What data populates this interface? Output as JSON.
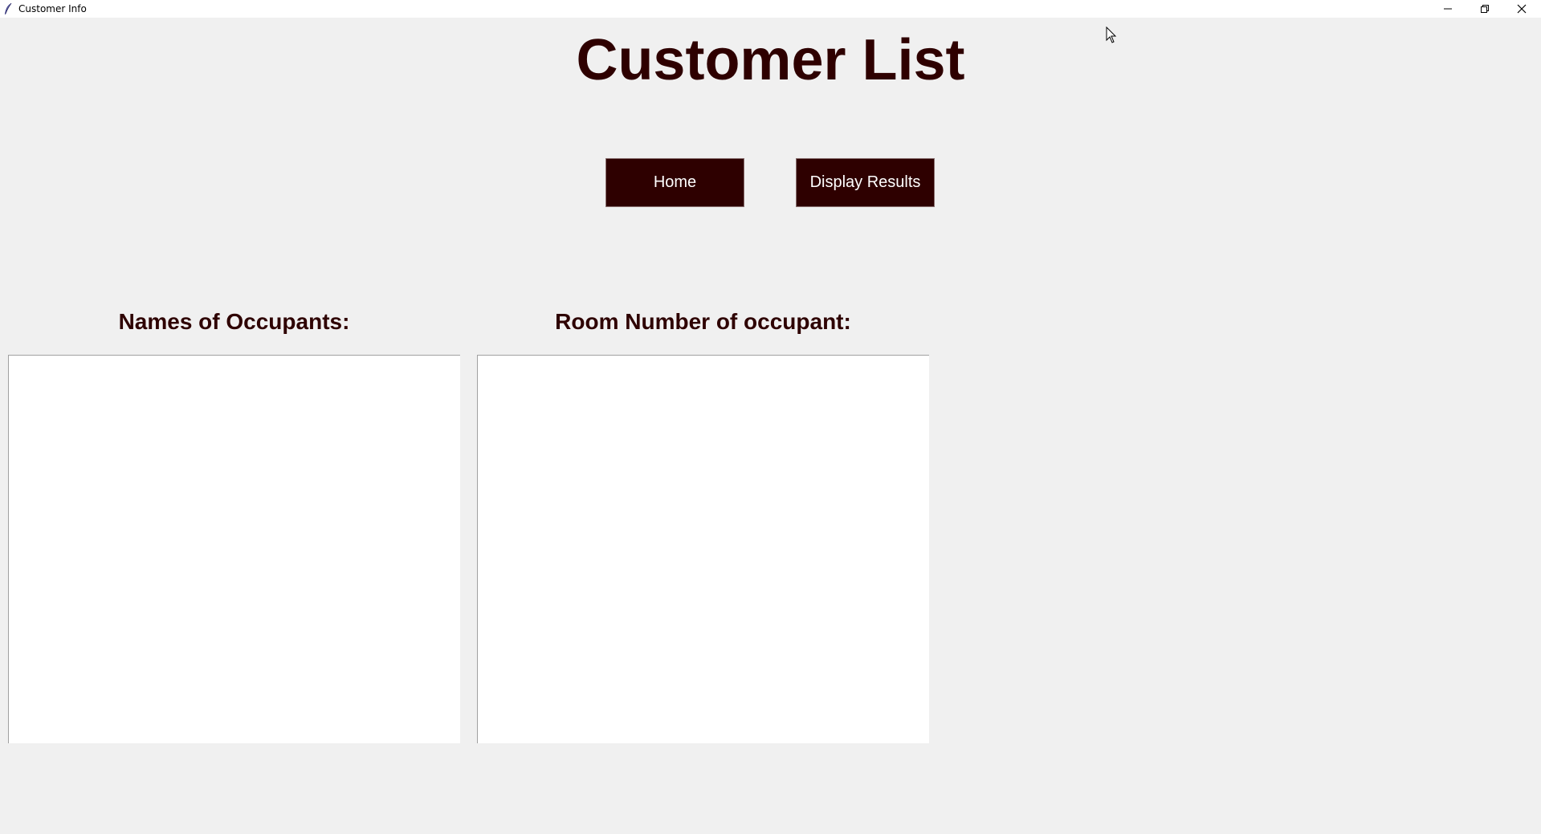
{
  "window": {
    "title": "Customer Info",
    "controls": {
      "minimize": "minimize",
      "maximize": "restore",
      "close": "close"
    }
  },
  "page": {
    "title": "Customer List"
  },
  "buttons": {
    "home_label": "Home",
    "display_label": "Display Results"
  },
  "columns": {
    "names_label": "Names of Occupants:",
    "rooms_label": "Room Number of occupant:"
  },
  "lists": {
    "names": [],
    "rooms": []
  },
  "colors": {
    "accent": "#2e0000",
    "background": "#f0f0f0",
    "listbox": "#ffffff"
  },
  "icons": {
    "app": "feather-icon",
    "minimize": "minimize-icon",
    "maximize": "restore-icon",
    "close": "close-icon",
    "cursor": "mouse-pointer-icon"
  }
}
